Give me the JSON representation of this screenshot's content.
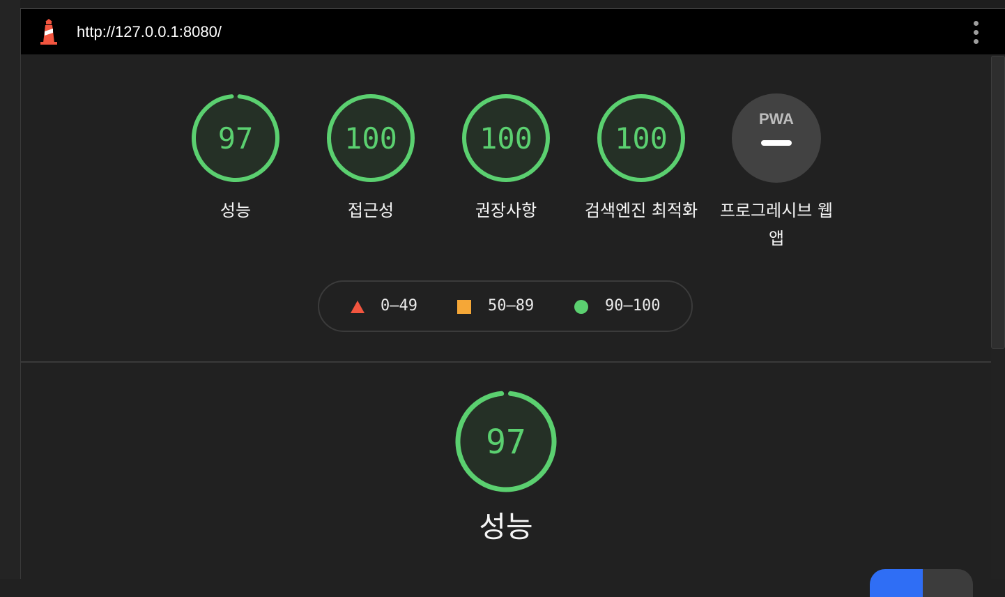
{
  "url": "http://127.0.0.1:8080/",
  "categories": [
    {
      "label": "성능",
      "score": "97",
      "fraction": 0.97
    },
    {
      "label": "접근성",
      "score": "100",
      "fraction": 1.0
    },
    {
      "label": "권장사항",
      "score": "100",
      "fraction": 1.0
    },
    {
      "label": "검색엔진 최적화",
      "score": "100",
      "fraction": 1.0
    },
    {
      "label": "프로그레시브 웹 앱",
      "badge": "PWA"
    }
  ],
  "legend": [
    {
      "range": "0–49",
      "shape": "triangle",
      "color": "#f2553f"
    },
    {
      "range": "50–89",
      "shape": "square",
      "color": "#f5a737"
    },
    {
      "range": "90–100",
      "shape": "circle",
      "color": "#5bd070"
    }
  ],
  "main_score": {
    "label": "성능",
    "score": "97",
    "fraction": 0.97
  },
  "colors": {
    "pass": "#5bd070",
    "pass_bg": "#253026",
    "neutral": "#424242"
  }
}
